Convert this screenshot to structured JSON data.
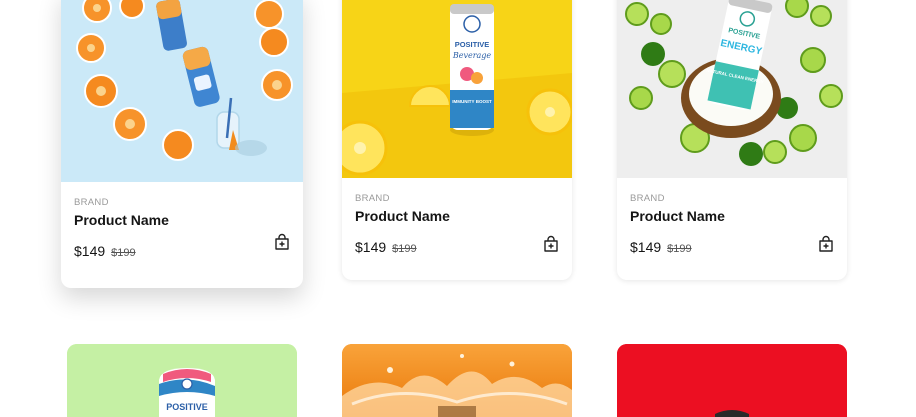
{
  "products": [
    {
      "brand": "BRAND",
      "name": "Product Name",
      "price": "$149",
      "old_price": "$199"
    },
    {
      "brand": "BRAND",
      "name": "Product Name",
      "price": "$149",
      "old_price": "$199"
    },
    {
      "brand": "BRAND",
      "name": "Product Name",
      "price": "$149",
      "old_price": "$199"
    }
  ],
  "can_labels": {
    "beverage": "POSITIVE",
    "beverage_sub": "Beverage",
    "beverage_boost": "IMMUNITY BOOST",
    "energy": "POSITIVE",
    "energy_sub": "ENERGY",
    "energy_tag": "NATURAL CLEAN ENERGY",
    "bottom": "POSITIVE"
  },
  "colors": {
    "card1_bg": "#cbe9f8",
    "card2_bg": "#f7d417",
    "card3_bg": "#eeeeee",
    "card4_bg": "#c5f0a4",
    "card5_bg": "#f48a0f",
    "card6_bg": "#ec0f22"
  }
}
